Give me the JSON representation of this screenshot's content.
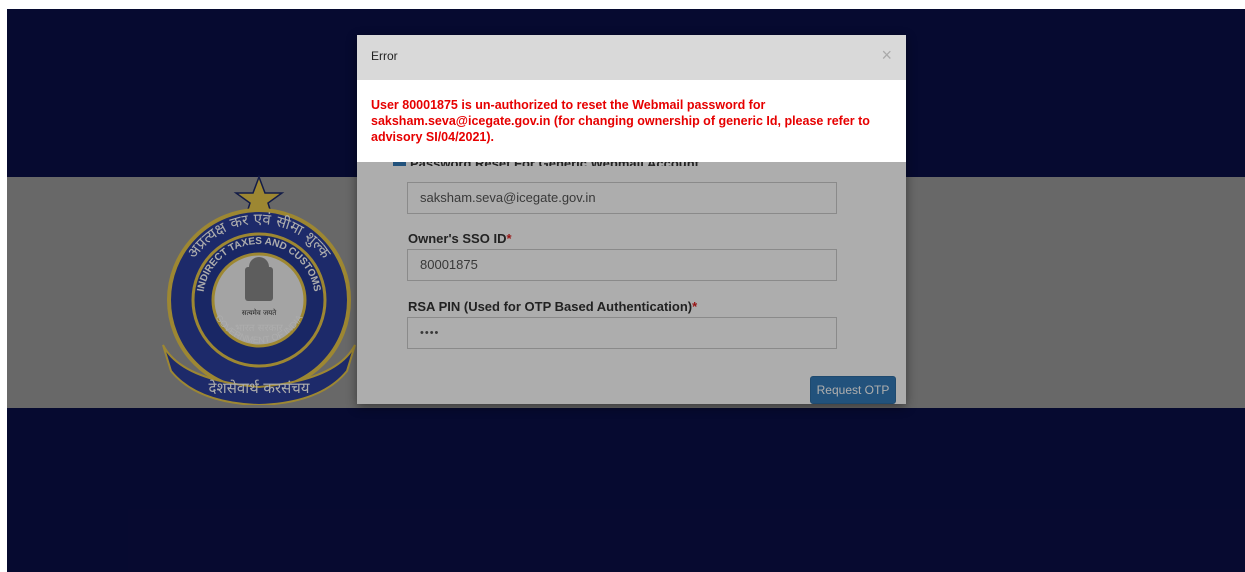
{
  "error_dialog": {
    "title": "Error",
    "close_glyph": "×",
    "message": "User 80001875 is un-authorized to reset the Webmail password for saksham.seva@icegate.gov.in (for changing ownership of generic Id, please refer to advisory SI/04/2021)."
  },
  "form": {
    "reset_option_label": "Password Reset For Generic Webmail Account",
    "email_value": "saksham.seva@icegate.gov.in",
    "sso_label": "Owner's SSO ID",
    "sso_value": "80001875",
    "rsa_label": "RSA PIN (Used for OTP Based Authentication)",
    "rsa_value": "••••",
    "required_mark": "*",
    "request_otp_label": "Request OTP"
  },
  "emblem": {
    "ring_text": "INDIRECT TAXES AND CUSTOMS",
    "motto": "सत्यमेव जयते",
    "center_text": "भारत सरकार",
    "banner_text": "GOVERNMENT OF INDIA",
    "ribbon_text": "देशसेवार्थ करसंचय",
    "hindi_arc": "अप्रत्यक्ष कर एवं सीमा शुल्क"
  },
  "colors": {
    "page_background": "#0a0f47",
    "error_text": "#e60000",
    "primary_button": "#337ab7"
  }
}
